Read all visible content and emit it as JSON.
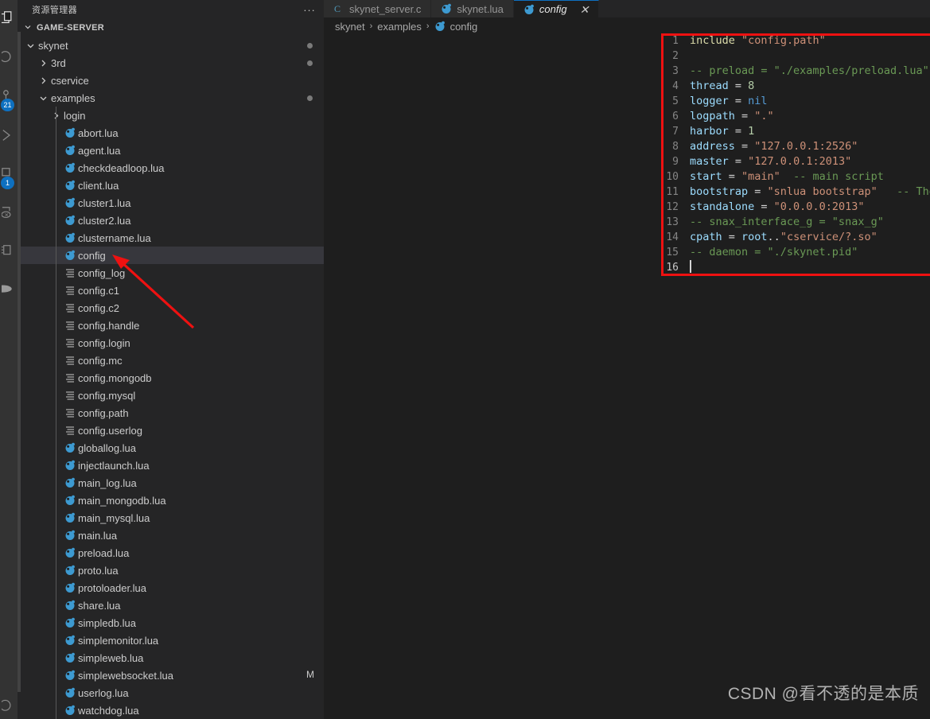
{
  "theme": {
    "bg_editor": "#1e1e1e",
    "bg_sidebar": "#252526",
    "bg_activitybar": "#333333",
    "selection": "#37373d",
    "accent": "#0e70c0",
    "annotation_red": "#ee1111",
    "text": "#cccccc",
    "keyword_blue": "#9cdcfe",
    "string_orange": "#ce9178",
    "comment_green": "#6a9955",
    "number_green": "#b5cea8",
    "nil_blue": "#569cd6",
    "include_yellow": "#dcdcaa"
  },
  "activitybar": {
    "items": [
      {
        "name": "explorer-icon",
        "badge": null
      },
      {
        "name": "search-icon",
        "badge": null
      },
      {
        "name": "source-control-icon",
        "badge": "21"
      },
      {
        "name": "run-debug-icon",
        "badge": null
      },
      {
        "name": "extensions-icon",
        "badge": "1"
      },
      {
        "name": "remote-explorer-icon",
        "badge": null
      },
      {
        "name": "testing-icon",
        "badge": null
      },
      {
        "name": "docker-icon",
        "badge": null
      },
      {
        "name": "accounts-icon",
        "badge": null
      }
    ]
  },
  "sidebar": {
    "title": "资源管理器",
    "more_actions": "...",
    "root_folder": "GAME-SERVER",
    "tree": [
      {
        "label": "skynet",
        "type": "folder",
        "state": "expanded",
        "indent": 1,
        "dot": true
      },
      {
        "label": "3rd",
        "type": "folder",
        "state": "collapsed",
        "indent": 2,
        "dot": true
      },
      {
        "label": "cservice",
        "type": "folder",
        "state": "collapsed",
        "indent": 2,
        "dot": false
      },
      {
        "label": "examples",
        "type": "folder",
        "state": "expanded",
        "indent": 2,
        "dot": true
      },
      {
        "label": "login",
        "type": "folder",
        "state": "collapsed",
        "indent": 3,
        "dot": false
      },
      {
        "label": "abort.lua",
        "type": "lua",
        "indent": 3
      },
      {
        "label": "agent.lua",
        "type": "lua",
        "indent": 3
      },
      {
        "label": "checkdeadloop.lua",
        "type": "lua",
        "indent": 3
      },
      {
        "label": "client.lua",
        "type": "lua",
        "indent": 3
      },
      {
        "label": "cluster1.lua",
        "type": "lua",
        "indent": 3
      },
      {
        "label": "cluster2.lua",
        "type": "lua",
        "indent": 3
      },
      {
        "label": "clustername.lua",
        "type": "lua",
        "indent": 3
      },
      {
        "label": "config",
        "type": "lua",
        "indent": 3,
        "selected": true
      },
      {
        "label": "config_log",
        "type": "conf",
        "indent": 3
      },
      {
        "label": "config.c1",
        "type": "conf",
        "indent": 3
      },
      {
        "label": "config.c2",
        "type": "conf",
        "indent": 3
      },
      {
        "label": "config.handle",
        "type": "conf",
        "indent": 3
      },
      {
        "label": "config.login",
        "type": "conf",
        "indent": 3
      },
      {
        "label": "config.mc",
        "type": "conf",
        "indent": 3
      },
      {
        "label": "config.mongodb",
        "type": "conf",
        "indent": 3
      },
      {
        "label": "config.mysql",
        "type": "conf",
        "indent": 3
      },
      {
        "label": "config.path",
        "type": "conf",
        "indent": 3
      },
      {
        "label": "config.userlog",
        "type": "conf",
        "indent": 3
      },
      {
        "label": "globallog.lua",
        "type": "lua",
        "indent": 3
      },
      {
        "label": "injectlaunch.lua",
        "type": "lua",
        "indent": 3
      },
      {
        "label": "main_log.lua",
        "type": "lua",
        "indent": 3
      },
      {
        "label": "main_mongodb.lua",
        "type": "lua",
        "indent": 3
      },
      {
        "label": "main_mysql.lua",
        "type": "lua",
        "indent": 3
      },
      {
        "label": "main.lua",
        "type": "lua",
        "indent": 3
      },
      {
        "label": "preload.lua",
        "type": "lua",
        "indent": 3
      },
      {
        "label": "proto.lua",
        "type": "lua",
        "indent": 3
      },
      {
        "label": "protoloader.lua",
        "type": "lua",
        "indent": 3
      },
      {
        "label": "share.lua",
        "type": "lua",
        "indent": 3
      },
      {
        "label": "simpledb.lua",
        "type": "lua",
        "indent": 3
      },
      {
        "label": "simplemonitor.lua",
        "type": "lua",
        "indent": 3
      },
      {
        "label": "simpleweb.lua",
        "type": "lua",
        "indent": 3
      },
      {
        "label": "simplewebsocket.lua",
        "type": "lua",
        "indent": 3,
        "badge": "M"
      },
      {
        "label": "userlog.lua",
        "type": "lua",
        "indent": 3
      },
      {
        "label": "watchdog.lua",
        "type": "lua",
        "indent": 3
      }
    ]
  },
  "editor": {
    "tabs": [
      {
        "label": "skynet_server.c",
        "icon": "c-file-icon",
        "active": false,
        "closable": false
      },
      {
        "label": "skynet.lua",
        "icon": "lua-file-icon",
        "active": false,
        "closable": false
      },
      {
        "label": "config",
        "icon": "lua-file-icon",
        "active": true,
        "closable": true,
        "close_label": "✕"
      }
    ],
    "breadcrumb": [
      {
        "label": "skynet",
        "icon": null
      },
      {
        "label": "examples",
        "icon": null
      },
      {
        "label": "config",
        "icon": "lua-file-icon"
      }
    ],
    "breadcrumb_separator": "›",
    "cursor_line": 16,
    "lines": [
      {
        "n": 1,
        "tokens": [
          {
            "t": "inc",
            "v": "include"
          },
          {
            "t": "plain",
            "v": " "
          },
          {
            "t": "str",
            "v": "\"config.path\""
          }
        ]
      },
      {
        "n": 2,
        "tokens": []
      },
      {
        "n": 3,
        "tokens": [
          {
            "t": "com",
            "v": "-- preload = \"./examples/preload.lua\"   -- run preload.lua before every lua service run"
          }
        ]
      },
      {
        "n": 4,
        "tokens": [
          {
            "t": "key",
            "v": "thread"
          },
          {
            "t": "op",
            "v": " = "
          },
          {
            "t": "num",
            "v": "8"
          }
        ]
      },
      {
        "n": 5,
        "tokens": [
          {
            "t": "key",
            "v": "logger"
          },
          {
            "t": "op",
            "v": " = "
          },
          {
            "t": "nil",
            "v": "nil"
          }
        ]
      },
      {
        "n": 6,
        "tokens": [
          {
            "t": "key",
            "v": "logpath"
          },
          {
            "t": "op",
            "v": " = "
          },
          {
            "t": "str",
            "v": "\".\""
          }
        ]
      },
      {
        "n": 7,
        "tokens": [
          {
            "t": "key",
            "v": "harbor"
          },
          {
            "t": "op",
            "v": " = "
          },
          {
            "t": "num",
            "v": "1"
          }
        ]
      },
      {
        "n": 8,
        "tokens": [
          {
            "t": "key",
            "v": "address"
          },
          {
            "t": "op",
            "v": " = "
          },
          {
            "t": "str",
            "v": "\"127.0.0.1:2526\""
          }
        ]
      },
      {
        "n": 9,
        "tokens": [
          {
            "t": "key",
            "v": "master"
          },
          {
            "t": "op",
            "v": " = "
          },
          {
            "t": "str",
            "v": "\"127.0.0.1:2013\""
          }
        ]
      },
      {
        "n": 10,
        "tokens": [
          {
            "t": "key",
            "v": "start"
          },
          {
            "t": "op",
            "v": " = "
          },
          {
            "t": "str",
            "v": "\"main\""
          },
          {
            "t": "plain",
            "v": "  "
          },
          {
            "t": "com",
            "v": "-- main script"
          }
        ]
      },
      {
        "n": 11,
        "tokens": [
          {
            "t": "key",
            "v": "bootstrap"
          },
          {
            "t": "op",
            "v": " = "
          },
          {
            "t": "str",
            "v": "\"snlua bootstrap\""
          },
          {
            "t": "plain",
            "v": "   "
          },
          {
            "t": "com",
            "v": "-- The service for bootstrap"
          }
        ]
      },
      {
        "n": 12,
        "tokens": [
          {
            "t": "key",
            "v": "standalone"
          },
          {
            "t": "op",
            "v": " = "
          },
          {
            "t": "str",
            "v": "\"0.0.0.0:2013\""
          }
        ]
      },
      {
        "n": 13,
        "tokens": [
          {
            "t": "com",
            "v": "-- snax_interface_g = \"snax_g\""
          }
        ]
      },
      {
        "n": 14,
        "tokens": [
          {
            "t": "key",
            "v": "cpath"
          },
          {
            "t": "op",
            "v": " = "
          },
          {
            "t": "key",
            "v": "root"
          },
          {
            "t": "op",
            "v": ".."
          },
          {
            "t": "str",
            "v": "\"cservice/?.so\""
          }
        ]
      },
      {
        "n": 15,
        "tokens": [
          {
            "t": "com",
            "v": "-- daemon = \"./skynet.pid\""
          }
        ]
      },
      {
        "n": 16,
        "tokens": [],
        "cursor": true
      }
    ]
  },
  "watermark": "CSDN @看不透的是本质"
}
